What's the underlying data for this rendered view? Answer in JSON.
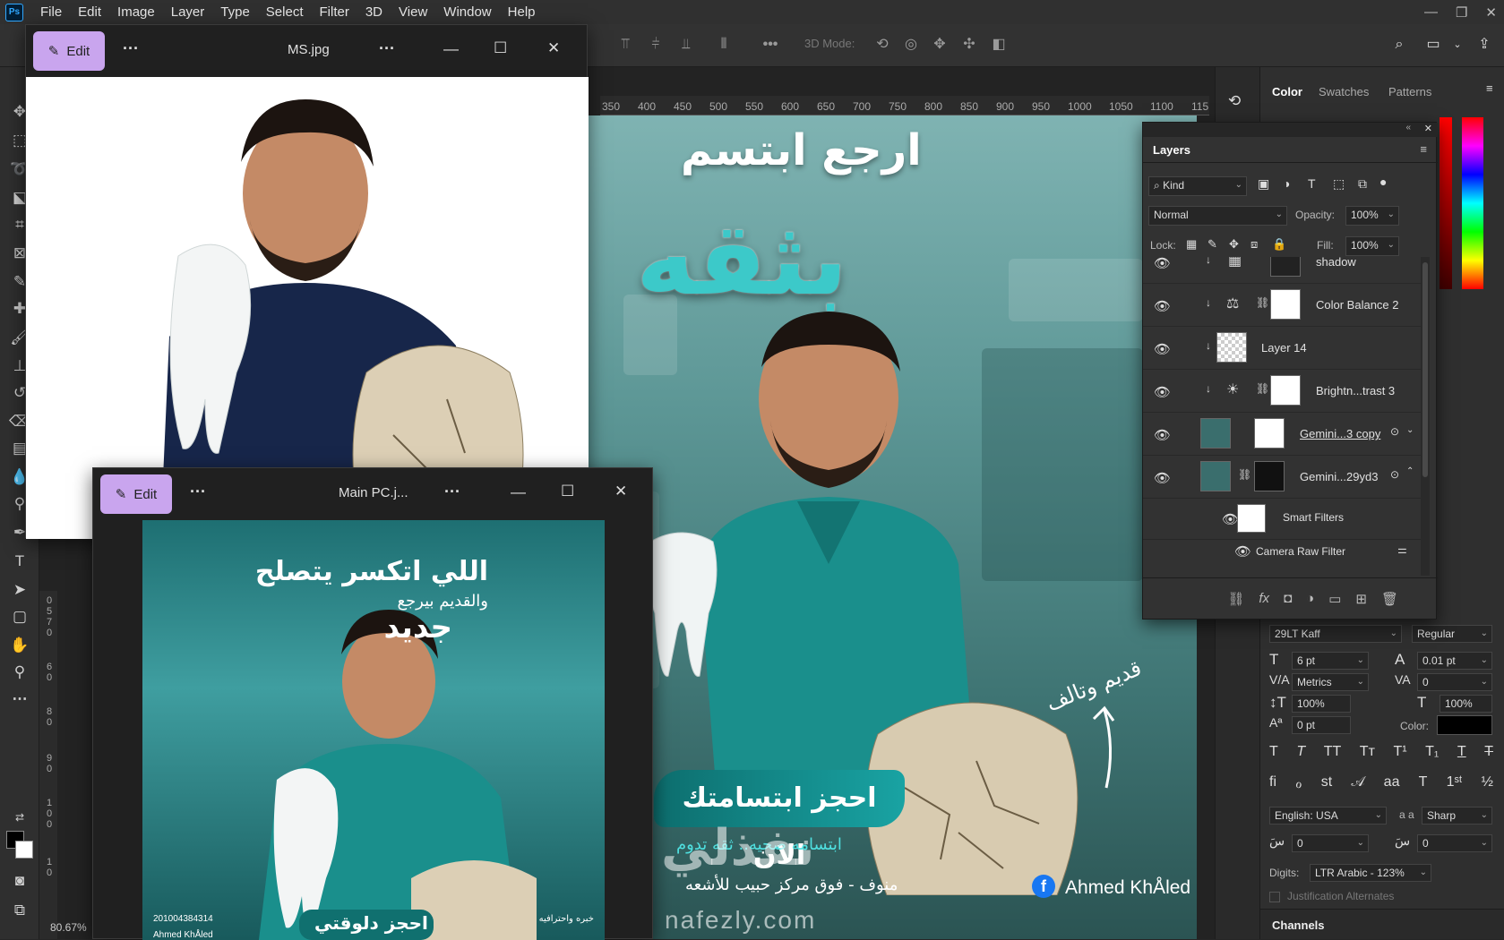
{
  "app": {
    "logo": "Ps"
  },
  "menu": [
    "File",
    "Edit",
    "Image",
    "Layer",
    "Type",
    "Select",
    "Filter",
    "3D",
    "View",
    "Window",
    "Help"
  ],
  "window_controls": {
    "minimize": "—",
    "restore": "❐",
    "close": "✕"
  },
  "options_bar": {
    "mode_3d_label": "3D Mode:"
  },
  "ruler": {
    "top_ticks": [
      "350",
      "400",
      "450",
      "500",
      "550",
      "600",
      "650",
      "700",
      "750",
      "800",
      "850",
      "900",
      "950",
      "1000",
      "1050",
      "1100",
      "115"
    ],
    "left_ticks": [
      "0",
      "5",
      "7",
      "0",
      "6",
      "0",
      "8",
      "0",
      "9",
      "0",
      "1",
      "0",
      "0",
      "1",
      "0"
    ]
  },
  "zoom": "80.67%",
  "photo_window_1": {
    "edit_label": "Edit",
    "title": "MS.jpg"
  },
  "photo_window_2": {
    "edit_label": "Edit",
    "title": "Main PC.j...",
    "poster": {
      "headline1": "اللي اتكسر يتصلح",
      "headline2": "والقديم بيرجع",
      "headline3": "جديد",
      "cta": "احجز دلوقتي",
      "phone": "201004384314",
      "author": "Ahmed KhÅled",
      "bullet1": "خبره واحترافيه"
    }
  },
  "poster": {
    "title_top": "ارجع ابتسم",
    "title_main": "بثقه",
    "arrow_text": "قديم وتالف",
    "badge": "احجز ابتسامتك الان",
    "tagline": "ابتسامه صحيه.. ثقه تدوم",
    "address": "منوف - فوق مركز حبيب للأشعه",
    "author": "Ahmed KhÅled",
    "watermark": "نفذلي",
    "watermark_url": "nafezly.com"
  },
  "right_tabs": {
    "color": "Color",
    "swatches": "Swatches",
    "patterns": "Patterns"
  },
  "layers_panel": {
    "title": "Layers",
    "kind": "Kind",
    "blend_mode": "Normal",
    "opacity_label": "Opacity:",
    "opacity": "100%",
    "lock_label": "Lock:",
    "fill_label": "Fill:",
    "fill": "100%",
    "layers": [
      {
        "name": "shadow"
      },
      {
        "name": "Color Balance 2"
      },
      {
        "name": "Layer 14"
      },
      {
        "name": "Brightn...trast 3"
      },
      {
        "name": "Gemini...3 copy"
      },
      {
        "name": "Gemini...29yd3"
      },
      {
        "name": "Smart Filters"
      },
      {
        "name": "Camera Raw Filter"
      }
    ]
  },
  "character": {
    "font": "29LT Kaff",
    "style": "Regular",
    "size": "6 pt",
    "leading": "0.01 pt",
    "kerning": "Metrics",
    "tracking": "0",
    "v_scale": "100%",
    "h_scale": "100%",
    "baseline": "0 pt",
    "color_label": "Color:",
    "language": "English: USA",
    "aa_label": "a a",
    "antialias": "Sharp",
    "spacing1": "0",
    "spacing2": "0",
    "digits_label": "Digits:",
    "digits": "LTR Arabic - 123%",
    "justification": "Justification Alternates"
  },
  "channels_tab": "Channels"
}
